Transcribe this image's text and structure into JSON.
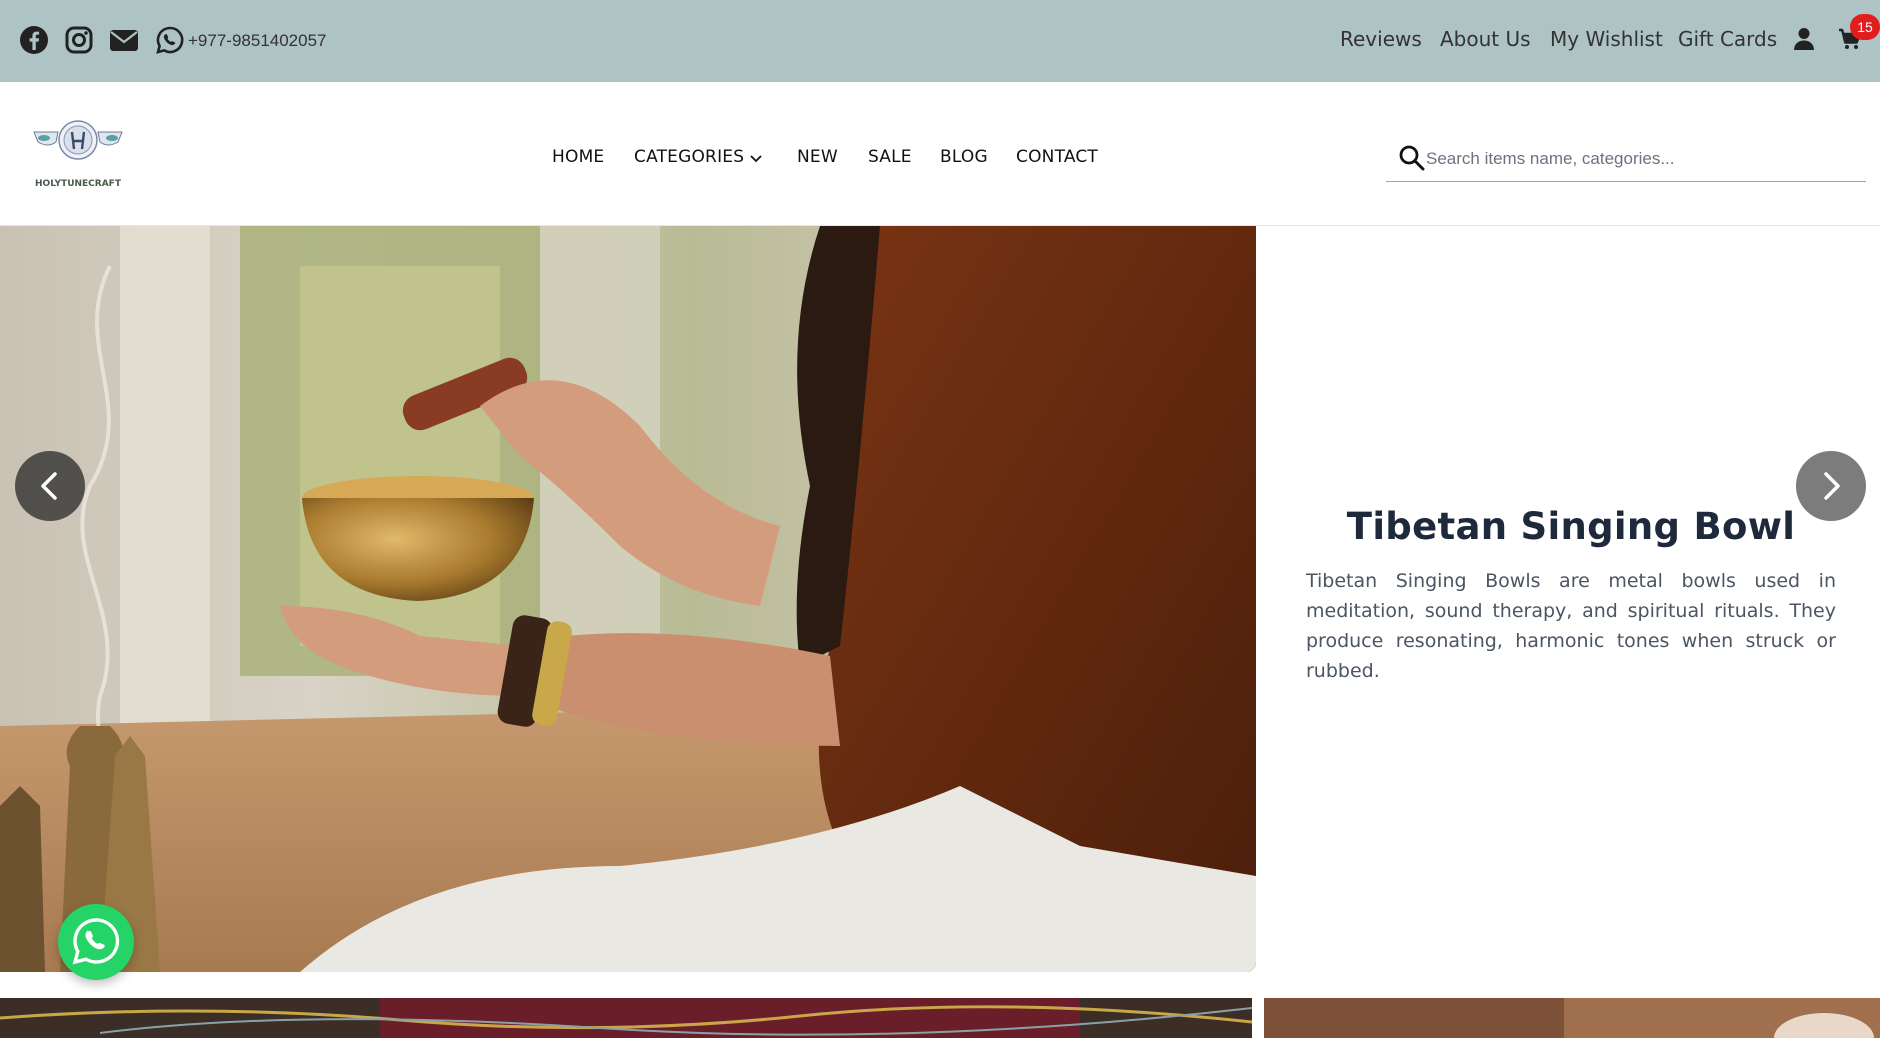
{
  "topbar": {
    "phone": "+977-9851402057",
    "links": [
      {
        "label": "Reviews"
      },
      {
        "label": "About Us"
      },
      {
        "label": "My Wishlist"
      },
      {
        "label": "Gift Cards"
      }
    ],
    "cart_count": "15",
    "bg_color": "#aec3c4"
  },
  "header": {
    "logo_text": "HOLYTUNECRAFT",
    "nav": [
      {
        "label": "HOME"
      },
      {
        "label": "CATEGORIES"
      },
      {
        "label": "NEW"
      },
      {
        "label": "SALE"
      },
      {
        "label": "BLOG"
      },
      {
        "label": "CONTACT"
      }
    ],
    "search_placeholder": "Search items name, categories..."
  },
  "hero": {
    "title": "Tibetan Singing Bowl",
    "description": "Tibetan Singing Bowls are metal bowls used in meditation, sound therapy, and spiritual rituals. They produce resonating, harmonic tones when struck or rubbed."
  },
  "icons": [
    "facebook-icon",
    "instagram-icon",
    "mail-icon",
    "whatsapp-icon",
    "user-icon",
    "cart-icon",
    "search-icon",
    "chevron-down-icon",
    "chevron-left-icon",
    "chevron-right-icon"
  ]
}
